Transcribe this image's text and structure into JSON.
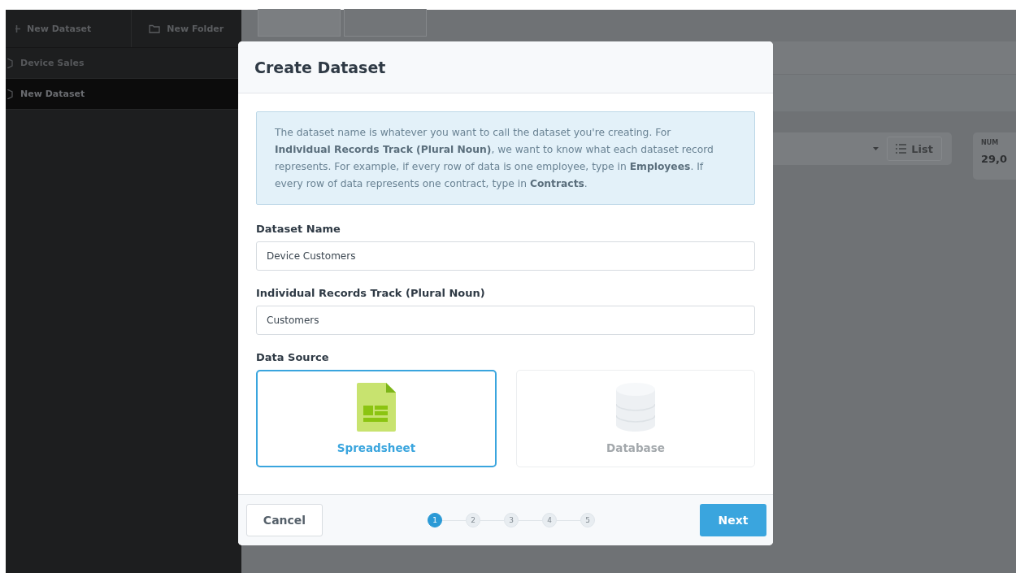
{
  "sidebar": {
    "toolbar": [
      {
        "label": "New Dataset",
        "kind": "add"
      },
      {
        "label": "New Folder",
        "kind": "folder"
      }
    ],
    "items": [
      {
        "label": "Device Sales",
        "selected": false
      },
      {
        "label": "New Dataset",
        "selected": true
      }
    ]
  },
  "background": {
    "list_button": "List",
    "stat": {
      "label": "NUM",
      "value": "29,0"
    }
  },
  "dialog": {
    "title": "Create Dataset",
    "info": "The dataset name is whatever you want to call the dataset you're creating. For **Individual Records Track (Plural Noun)**, we want to know what each dataset record represents. For example, if every row of data is one employee, type in **Employees**. If every row of data represents one contract, type in **Contracts**.",
    "fields": [
      {
        "label": "Dataset Name",
        "value": "Device Customers"
      },
      {
        "label": "Individual Records Track (Plural Noun)",
        "value": "Customers"
      }
    ],
    "data_source": {
      "label": "Data Source",
      "options": [
        {
          "label": "Spreadsheet",
          "kind": "spreadsheet",
          "selected": true
        },
        {
          "label": "Database",
          "kind": "database",
          "selected": false
        }
      ]
    },
    "cancel": "Cancel",
    "steps": [
      {
        "label": "1",
        "selected": true
      },
      {
        "label": "2",
        "selected": false
      },
      {
        "label": "3",
        "selected": false
      },
      {
        "label": "4",
        "selected": false
      },
      {
        "label": "5",
        "selected": false
      }
    ],
    "next": "Next"
  }
}
